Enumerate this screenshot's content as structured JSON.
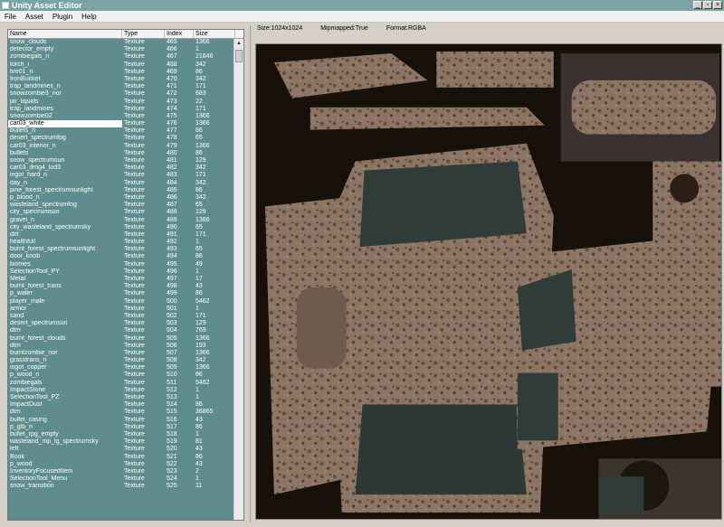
{
  "window": {
    "title": "Unity Asset Editor",
    "controls": [
      "_",
      "▫",
      "×"
    ]
  },
  "menu": [
    "File",
    "Asset",
    "Plugin",
    "Help"
  ],
  "list": {
    "columns": [
      "Name",
      "Type",
      "Index",
      "Size"
    ],
    "selected_index": 13,
    "rows": [
      [
        "snow_clouds",
        "Texture",
        "465",
        "1366"
      ],
      [
        "detector_empty",
        "Texture",
        "466",
        "1"
      ],
      [
        "zombiegals_n",
        "Texture",
        "467",
        "21846"
      ],
      [
        "torch_i",
        "Texture",
        "468",
        "342"
      ],
      [
        "tire01_n",
        "Texture",
        "469",
        "86"
      ],
      [
        "IronBucket",
        "Texture",
        "470",
        "342"
      ],
      [
        "trap_landmines_n",
        "Texture",
        "471",
        "171"
      ],
      [
        "snowzombie3_nor",
        "Texture",
        "472",
        "683"
      ],
      [
        "jar_liquids",
        "Texture",
        "473",
        "22"
      ],
      [
        "trap_landmines",
        "Texture",
        "474",
        "171"
      ],
      [
        "snowzombie02",
        "Texture",
        "475",
        "1366"
      ],
      [
        "car03_white",
        "Texture",
        "476",
        "1366"
      ],
      [
        "bullets_n",
        "Texture",
        "477",
        "86"
      ],
      [
        "desert_spectrumfog",
        "Texture",
        "478",
        "65"
      ],
      [
        "car03_interior_n",
        "Texture",
        "479",
        "1366"
      ],
      [
        "bullets",
        "Texture",
        "480",
        "86"
      ],
      [
        "snow_spectrumsun",
        "Texture",
        "481",
        "129"
      ],
      [
        "car03_dmg4_lod3",
        "Texture",
        "482",
        "342"
      ],
      [
        "ingot_hard_n",
        "Texture",
        "483",
        "171"
      ],
      [
        "day_n",
        "Texture",
        "484",
        "342"
      ],
      [
        "pine_forest_spectrumsunlight",
        "Texture",
        "485",
        "86"
      ],
      [
        "p_blood_n",
        "Texture",
        "486",
        "342"
      ],
      [
        "wasteland_spectrumfog",
        "Texture",
        "487",
        "65"
      ],
      [
        "city_spectrumsun",
        "Texture",
        "488",
        "129"
      ],
      [
        "gravel_n",
        "Texture",
        "489",
        "1366"
      ],
      [
        "city_wasteland_spectrumsky",
        "Texture",
        "490",
        "65"
      ],
      [
        "dirt",
        "Texture",
        "491",
        "171"
      ],
      [
        "healthfull",
        "Texture",
        "492",
        "1"
      ],
      [
        "burnt_forest_spectrumsunlight",
        "Texture",
        "493",
        "65"
      ],
      [
        "door_knob",
        "Texture",
        "494",
        "86"
      ],
      [
        "biomes",
        "Texture",
        "495",
        "49"
      ],
      [
        "SelectionTool_PY",
        "Texture",
        "496",
        "1"
      ],
      [
        "Metal",
        "Texture",
        "497",
        "17"
      ],
      [
        "burnt_forest_trans",
        "Texture",
        "498",
        "43"
      ],
      [
        "p_water",
        "Texture",
        "499",
        "86"
      ],
      [
        "player_male",
        "Texture",
        "500",
        "5462"
      ],
      [
        "armor",
        "Texture",
        "501",
        "1"
      ],
      [
        "sand",
        "Texture",
        "502",
        "171"
      ],
      [
        "desert_spectrumsun",
        "Texture",
        "503",
        "129"
      ],
      [
        "dtm",
        "Texture",
        "504",
        "769"
      ],
      [
        "burnt_forest_clouds",
        "Texture",
        "505",
        "1366"
      ],
      [
        "dtm",
        "Texture",
        "506",
        "193"
      ],
      [
        "burntzombie_nor",
        "Texture",
        "507",
        "1366"
      ],
      [
        "grasstrans_n",
        "Texture",
        "508",
        "342"
      ],
      [
        "ingot_copper",
        "Texture",
        "509",
        "1366"
      ],
      [
        "p_wood_n",
        "Texture",
        "510",
        "86"
      ],
      [
        "zombiegals",
        "Texture",
        "511",
        "5462"
      ],
      [
        "ImpactStone",
        "Texture",
        "512",
        "1"
      ],
      [
        "SelectionTool_PZ",
        "Texture",
        "513",
        "1"
      ],
      [
        "ImpactDust",
        "Texture",
        "514",
        "86"
      ],
      [
        "dtm",
        "Texture",
        "515",
        "36865"
      ],
      [
        "bullet_casing",
        "Texture",
        "516",
        "43"
      ],
      [
        "p_glb_n",
        "Texture",
        "517",
        "86"
      ],
      [
        "bullet_rpg_empty",
        "Texture",
        "518",
        "1"
      ],
      [
        "wasteland_mp_lg_spectrumsky",
        "Texture",
        "519",
        "81"
      ],
      [
        "left",
        "Texture",
        "520",
        "43"
      ],
      [
        "Book",
        "Texture",
        "521",
        "86"
      ],
      [
        "p_wood",
        "Texture",
        "522",
        "43"
      ],
      [
        "InventoryFocusedItem",
        "Texture",
        "523",
        "2"
      ],
      [
        "SelectionTool_Menu",
        "Texture",
        "524",
        "1"
      ],
      [
        "snow_transition",
        "Texture",
        "525",
        "11"
      ]
    ]
  },
  "preview_info": {
    "size": "Size:1024x1024",
    "mipmapped": "Mipmapped:True",
    "format": "Format:RGBA"
  },
  "colors": {
    "titlebar": "#7aa3a3",
    "list_bg": "#5f8c8c",
    "texture_dark": "#17110c",
    "rust_panel": "#8a7566",
    "glass": "#2f3c38"
  }
}
